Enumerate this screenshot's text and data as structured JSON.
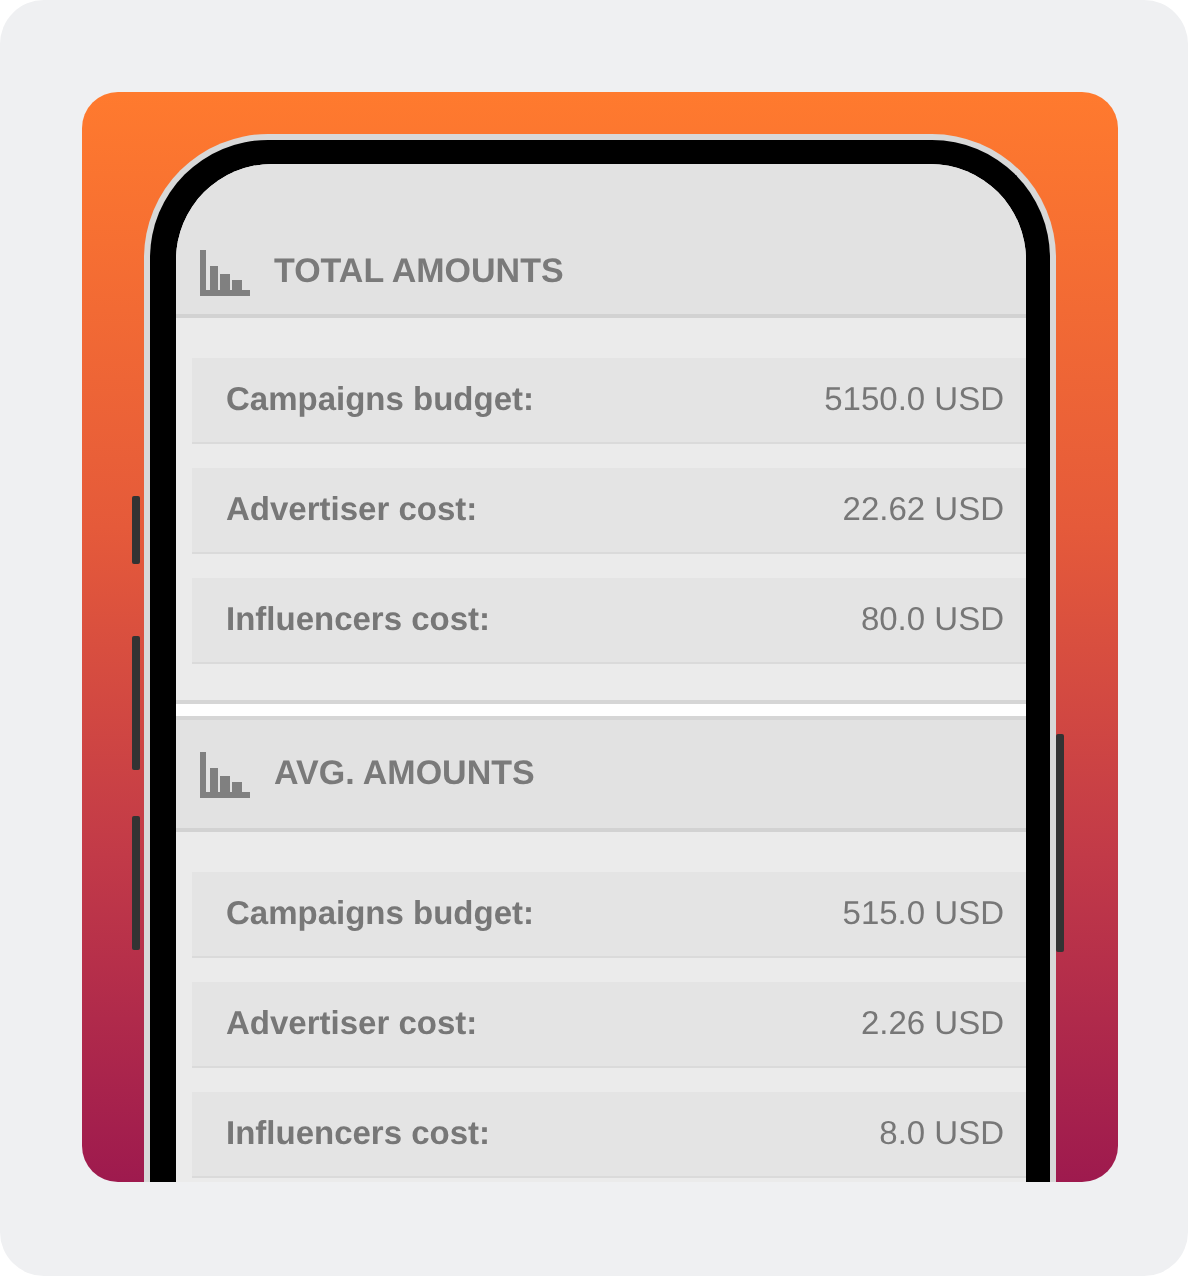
{
  "sections": [
    {
      "title": "TOTAL AMOUNTS",
      "rows": [
        {
          "label": "Campaigns budget:",
          "value": "5150.0 USD"
        },
        {
          "label": "Advertiser cost:",
          "value": "22.62 USD"
        },
        {
          "label": "Influencers cost:",
          "value": "80.0 USD"
        }
      ]
    },
    {
      "title": "AVG. AMOUNTS",
      "rows": [
        {
          "label": "Campaigns budget:",
          "value": "515.0 USD"
        },
        {
          "label": "Advertiser cost:",
          "value": "2.26 USD"
        },
        {
          "label": "Influencers cost:",
          "value": "8.0 USD"
        }
      ]
    }
  ]
}
